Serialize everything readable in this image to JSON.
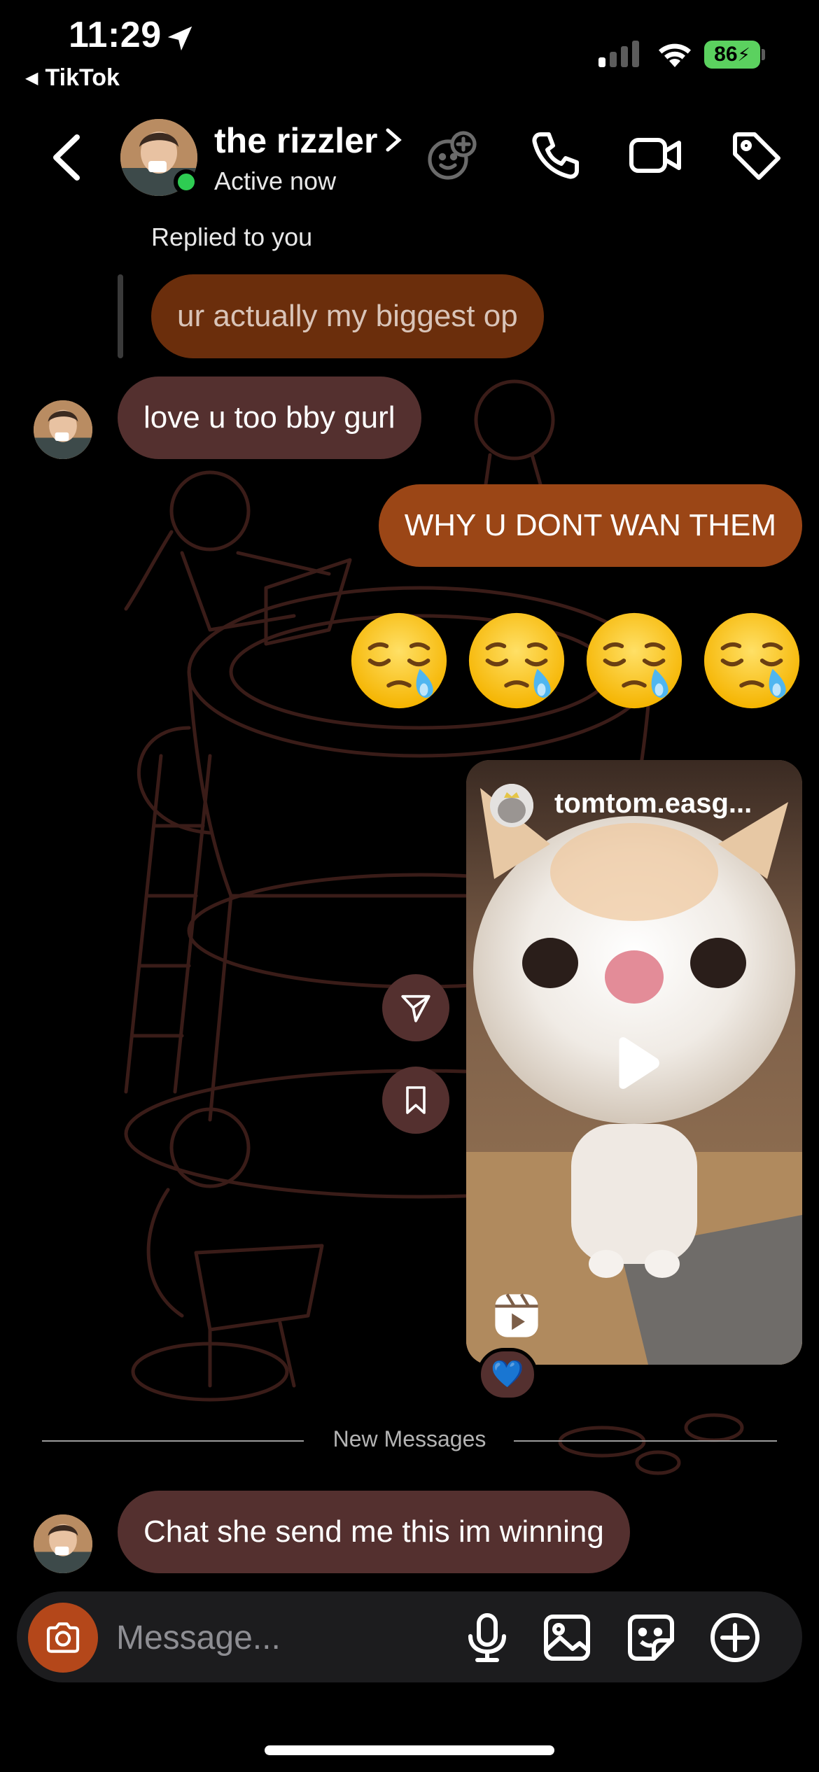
{
  "status_bar": {
    "time": "11:29",
    "back_app": "TikTok",
    "battery": "86"
  },
  "header": {
    "name": "the rizzler",
    "status": "Active now"
  },
  "messages": {
    "replied_label": "Replied to you",
    "reply_quote": "ur actually my biggest op",
    "m1": "love u too bby gurl",
    "m2": "WHY U DONT WAN THEM",
    "emoji_count": 4,
    "m3": "Chat she send me this im winning"
  },
  "reel": {
    "username": "tomtom.easg...",
    "reaction": "💙"
  },
  "divider": {
    "label": "New Messages"
  },
  "composer": {
    "placeholder": "Message..."
  },
  "colors": {
    "their_bubble": "#54302f",
    "my_bubble": "#9b4616",
    "online": "#2ecc52",
    "camera": "#b4471a",
    "battery": "#5bd15f"
  },
  "icons": [
    "location-arrow-icon",
    "signal-icon",
    "wifi-icon",
    "battery-icon",
    "back-chevron-icon",
    "add-people-icon",
    "phone-icon",
    "video-icon",
    "tag-icon",
    "share-icon",
    "bookmark-icon",
    "play-icon",
    "reels-icon",
    "camera-icon",
    "mic-icon",
    "gallery-icon",
    "sticker-icon",
    "plus-circle-icon"
  ]
}
